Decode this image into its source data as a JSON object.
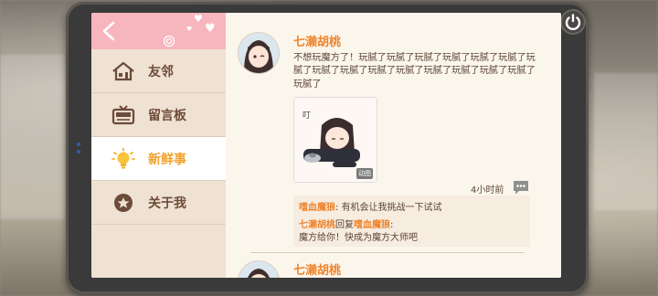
{
  "sidebar": {
    "items": [
      {
        "label": "友邻",
        "icon": "house-icon"
      },
      {
        "label": "留言板",
        "icon": "radio-icon"
      },
      {
        "label": "新鲜事",
        "icon": "lightbulb-icon",
        "active": true
      },
      {
        "label": "关于我",
        "icon": "star-badge-icon"
      }
    ]
  },
  "feed": {
    "post": {
      "author": "七濑胡桃",
      "text": "不想玩魔方了！玩腻了玩腻了玩腻了玩腻了玩腻了玩腻了玩腻了玩腻了玩腻了玩腻了玩腻了玩腻了玩腻了玩腻了玩腻了玩腻了",
      "image_badge": "动图",
      "image_text": "叮",
      "time": "4小时前",
      "comments": [
        {
          "author": "嗜血魔狼",
          "sep": ": ",
          "text": "有机会让我挑战一下试试"
        },
        {
          "author": "七濑胡桃",
          "mid": "回复",
          "target": "嗜血魔狼",
          "sep": ":",
          "text": "魔方给你！快成为魔方大师吧"
        }
      ]
    },
    "next_post": {
      "author": "七濑胡桃"
    }
  },
  "colors": {
    "accent_orange": "#f0832a",
    "sidebar_bg": "#efe2d2",
    "header_pink": "#f7b6bd",
    "text_brown": "#5d4536"
  }
}
